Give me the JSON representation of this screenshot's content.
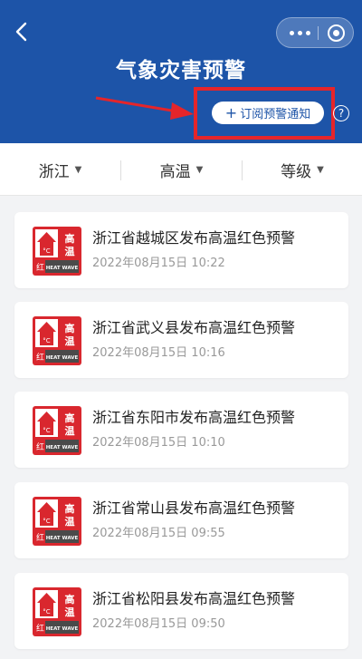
{
  "header": {
    "title": "气象灾害预警",
    "subscribe_label": "订阅预警通知",
    "subscribe_plus": "+",
    "help_symbol": "?"
  },
  "filters": [
    {
      "label": "浙江"
    },
    {
      "label": "高温"
    },
    {
      "label": "等级"
    }
  ],
  "badge": {
    "main_text": "高温",
    "corner_text": "红",
    "english_text": "HEAT WAVE",
    "unit_text": "°C",
    "color": "#d9272e"
  },
  "warnings": [
    {
      "title": "浙江省越城区发布高温红色预警",
      "time": "2022年08月15日 10:22"
    },
    {
      "title": "浙江省武义县发布高温红色预警",
      "time": "2022年08月15日 10:16"
    },
    {
      "title": "浙江省东阳市发布高温红色预警",
      "time": "2022年08月15日 10:10"
    },
    {
      "title": "浙江省常山县发布高温红色预警",
      "time": "2022年08月15日 09:55"
    },
    {
      "title": "浙江省松阳县发布高温红色预警",
      "time": "2022年08月15日 09:50"
    }
  ],
  "colors": {
    "header_blue": "#1d54a8",
    "highlight_red": "#e5252a"
  }
}
